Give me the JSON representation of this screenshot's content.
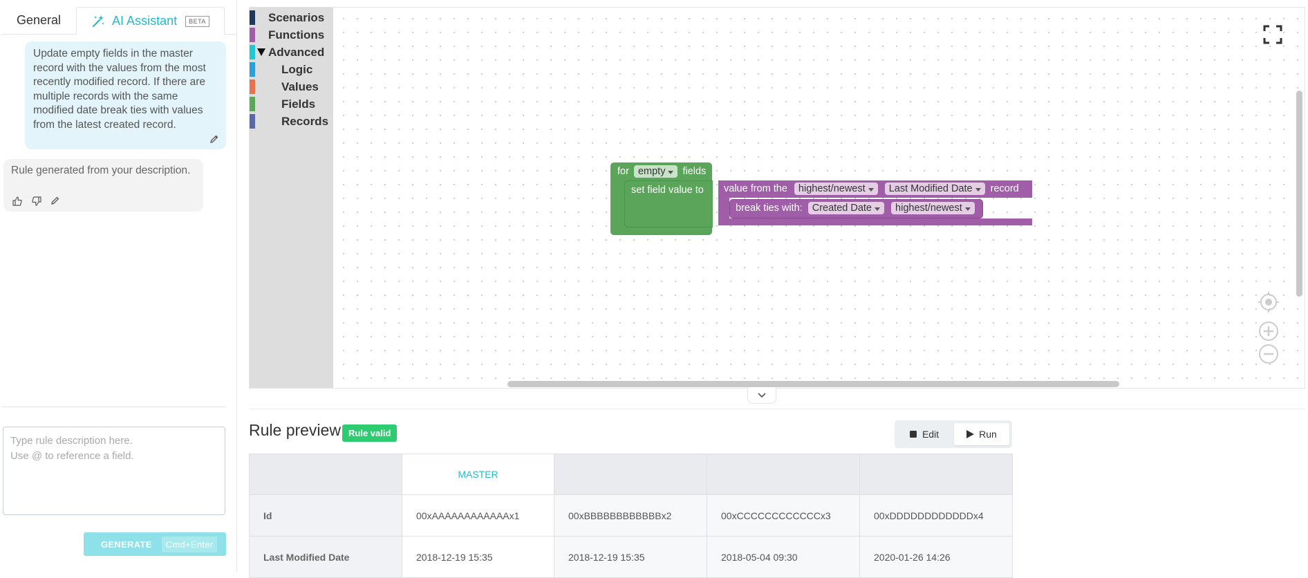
{
  "tabs": {
    "general": "General",
    "ai_assistant": "AI Assistant",
    "beta_badge": "BETA"
  },
  "chat": {
    "user_message": "Update empty fields in the master record with the values from the most recently modified record. If there are multiple records with the same modified date break ties with values from the latest created record.",
    "assistant_message": "Rule generated from your description."
  },
  "prompt": {
    "placeholder": "Type rule description here.\nUse @ to reference a field.",
    "value": ""
  },
  "generate": {
    "label": "GENERATE",
    "shortcut": "Cmd+Enter"
  },
  "toolbox": {
    "categories": [
      {
        "label": "Scenarios",
        "color": "#1e3a5f"
      },
      {
        "label": "Functions",
        "color": "#a15ea8"
      },
      {
        "label": "Advanced",
        "color": "#1ec8d6",
        "expanded": true
      },
      {
        "label": "Logic",
        "color": "#2d9fd8"
      },
      {
        "label": "Values",
        "color": "#e8734a"
      },
      {
        "label": "Fields",
        "color": "#5aa85a"
      },
      {
        "label": "Records",
        "color": "#5b68a8"
      }
    ]
  },
  "blocks": {
    "for_prefix": "for",
    "for_dropdown": "empty",
    "for_suffix": "fields",
    "set_label": "set field value to",
    "value_prefix": "value from the",
    "value_order": "highest/newest",
    "value_field": "Last Modified Date",
    "value_suffix": "record",
    "tie_label": "break ties with:",
    "tie_field": "Created Date",
    "tie_order": "highest/newest"
  },
  "preview": {
    "title": "Rule preview",
    "status": "Rule valid",
    "edit_label": "Edit",
    "run_label": "Run",
    "columns": [
      "",
      "MASTER",
      "",
      "",
      ""
    ],
    "rows": [
      {
        "label": "Id",
        "values": [
          "00xAAAAAAAAAAAAx1",
          "00xBBBBBBBBBBBBx2",
          "00xCCCCCCCCCCCCx3",
          "00xDDDDDDDDDDDDx4"
        ]
      },
      {
        "label": "Last Modified Date",
        "values": [
          "2018-12-19 15:35",
          "2018-12-19 15:35",
          "2018-05-04 09:30",
          "2020-01-26 14:26"
        ]
      }
    ]
  },
  "colors": {
    "accent": "#22bcc9",
    "valid": "#2ecc71",
    "block_green": "#5ba55b",
    "block_purple": "#a15ea8"
  }
}
